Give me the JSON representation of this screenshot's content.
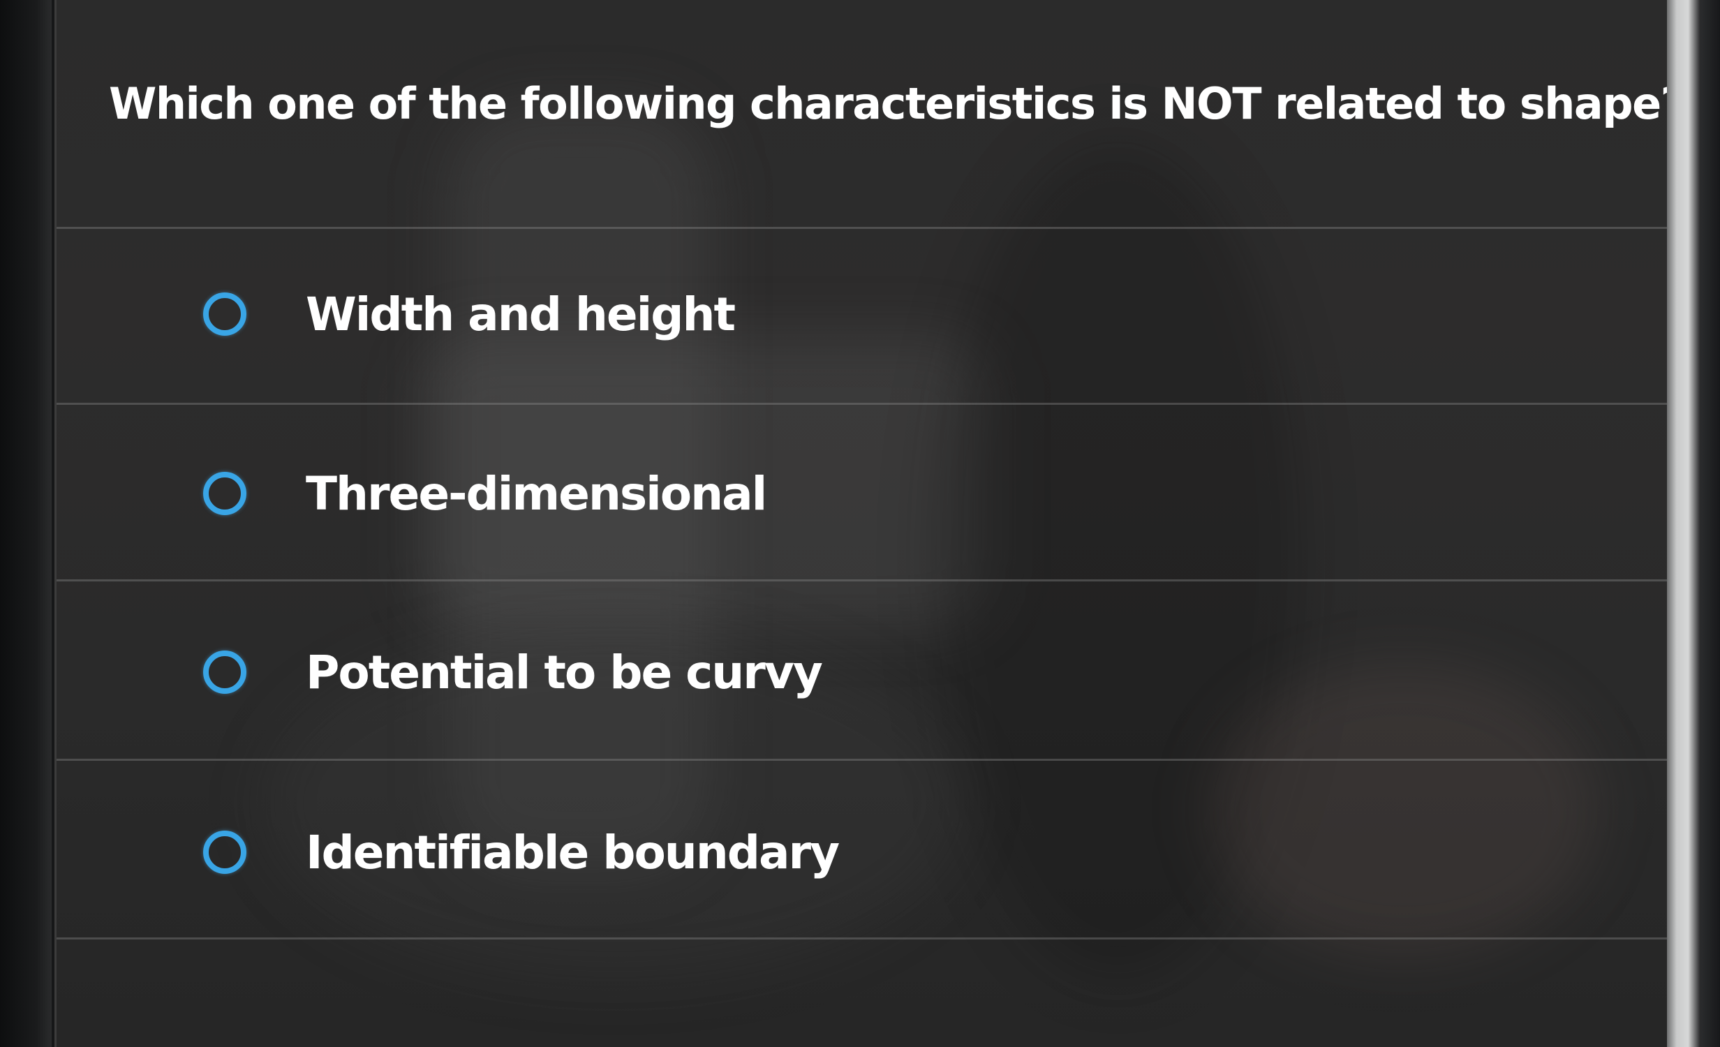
{
  "quiz": {
    "question": "Which one of the following characteristics is NOT related to shape?",
    "options": [
      {
        "label": "Width and height",
        "selected": false
      },
      {
        "label": "Three-dimensional",
        "selected": false
      },
      {
        "label": "Potential to be curvy",
        "selected": false
      },
      {
        "label": "Identifiable boundary",
        "selected": false
      }
    ]
  },
  "colors": {
    "panel_background": "#2b2b2b",
    "radio_accent": "#39a5e6",
    "text": "#ffffff"
  }
}
